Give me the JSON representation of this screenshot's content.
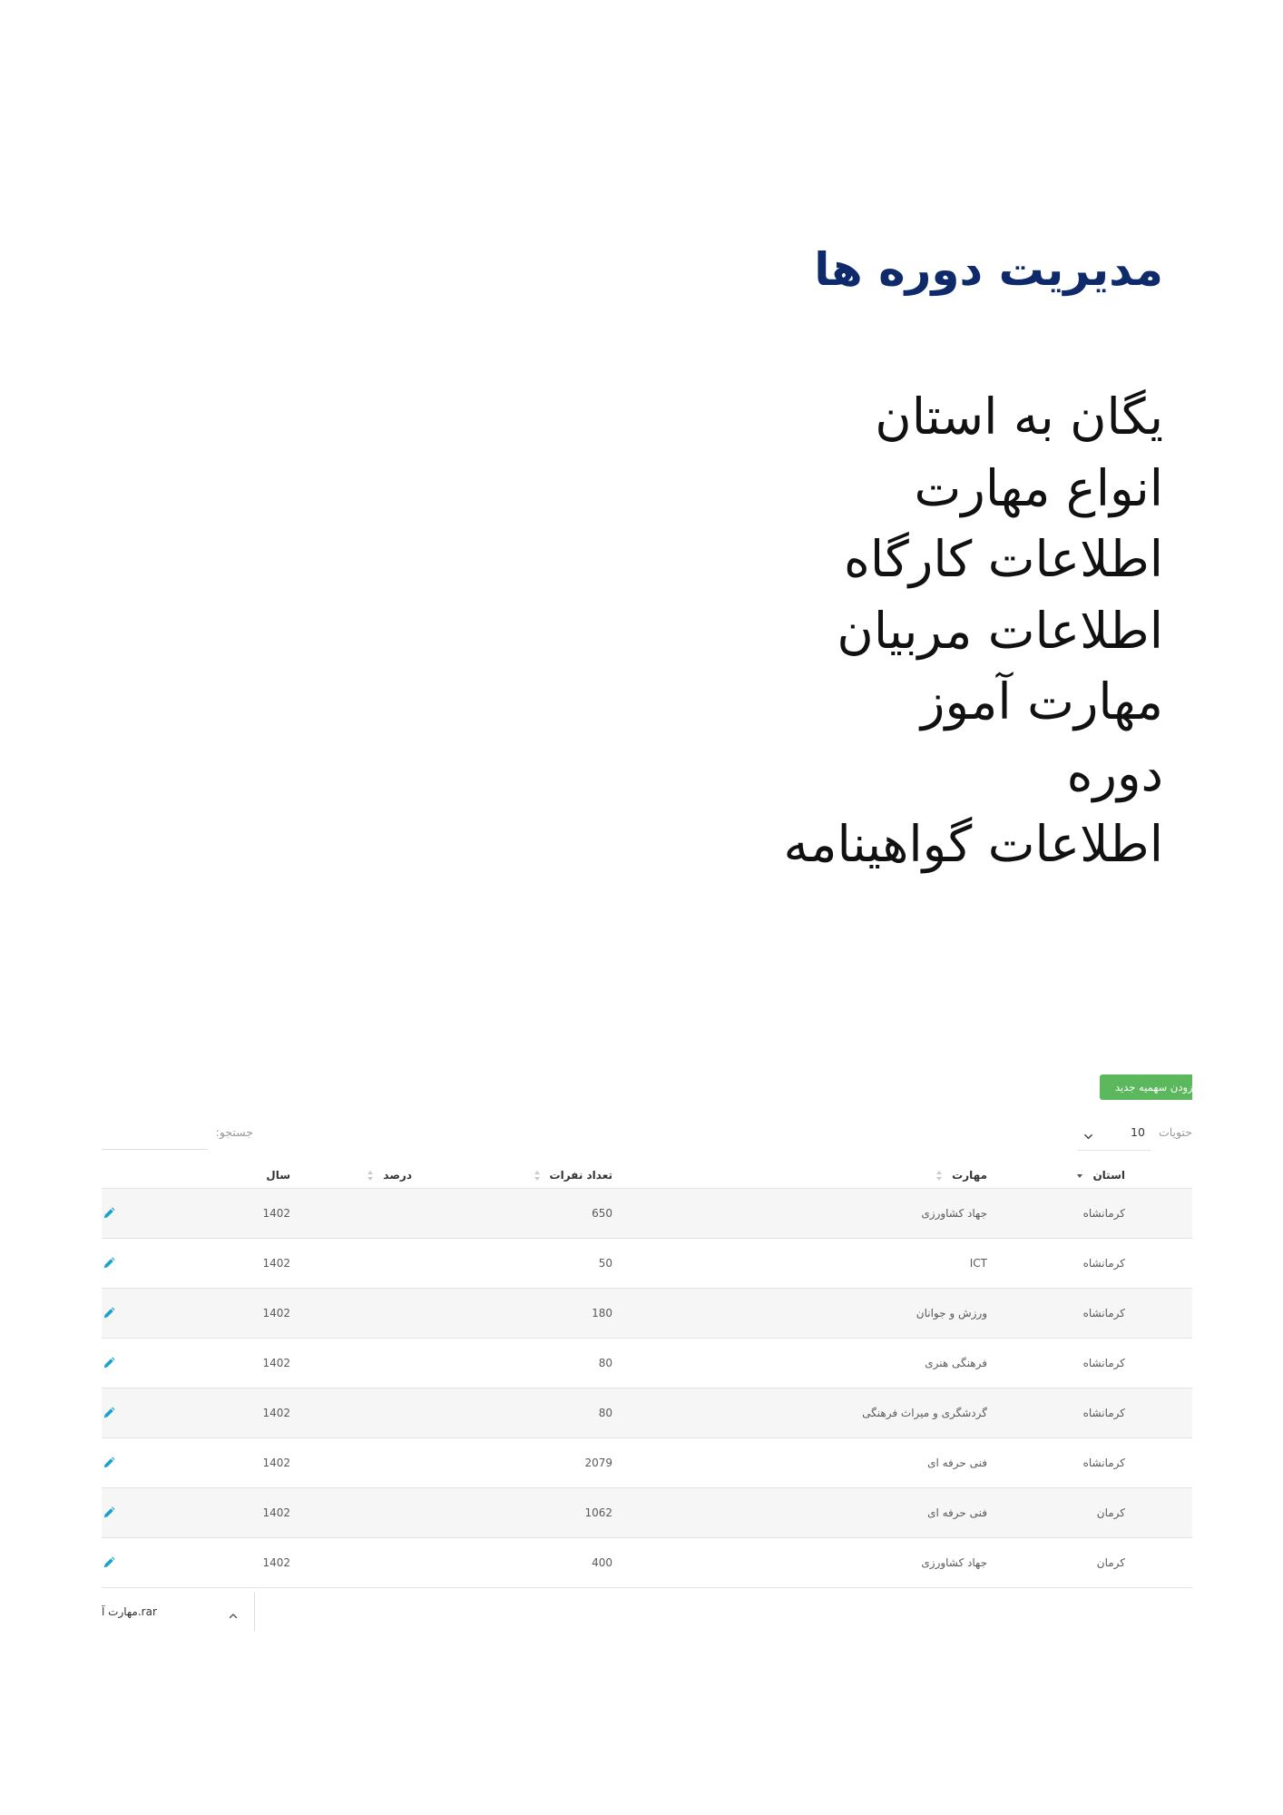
{
  "document": {
    "title": "مدیریت دوره ها",
    "items": [
      "یگان به استان",
      "انواع مهارت",
      "اطلاعات کارگاه",
      "اطلاعات مربیان",
      "مهارت آموز",
      "دوره",
      "اطلاعات گواهینامه"
    ]
  },
  "screenshot": {
    "add_button": {
      "label": "زودن سهمیه جدید"
    },
    "page_length": {
      "label": "حتویات",
      "value": "10",
      "icon": "chevron-down-icon"
    },
    "search": {
      "label": "جستجو:",
      "value": ""
    },
    "table": {
      "columns": [
        {
          "label": "استان",
          "sort_icon": "sort-desc-icon"
        },
        {
          "label": "مهارت",
          "sort_icon": "sort-icon"
        },
        {
          "label": "تعداد نفرات",
          "sort_icon": "sort-icon"
        },
        {
          "label": "درصد",
          "sort_icon": "sort-icon"
        },
        {
          "label": "سال"
        }
      ],
      "row_action_icon": "edit-icon",
      "rows": [
        {
          "province": "کرمانشاه",
          "skill": "جهاد کشاورزی",
          "count": 650,
          "percent": "",
          "year": 1402
        },
        {
          "province": "کرمانشاه",
          "skill": "ICT",
          "count": 50,
          "percent": "",
          "year": 1402
        },
        {
          "province": "کرمانشاه",
          "skill": "ورزش و جوانان",
          "count": 180,
          "percent": "",
          "year": 1402
        },
        {
          "province": "کرمانشاه",
          "skill": "فرهنگی هنری",
          "count": 80,
          "percent": "",
          "year": 1402
        },
        {
          "province": "کرمانشاه",
          "skill": "گردشگری و میراث فرهنگی",
          "count": 80,
          "percent": "",
          "year": 1402
        },
        {
          "province": "کرمانشاه",
          "skill": "فنی حرفه ای",
          "count": 2079,
          "percent": "",
          "year": 1402
        },
        {
          "province": "کرمان",
          "skill": "فنی حرفه ای",
          "count": 1062,
          "percent": "",
          "year": 1402
        },
        {
          "province": "کرمان",
          "skill": "جهاد کشاورزی",
          "count": 400,
          "percent": "",
          "year": 1402
        }
      ]
    },
    "download_bar": {
      "file_name": "مهارت آ.rar",
      "icon": "chevron-up-icon"
    }
  },
  "colors": {
    "title": "#0e2a6b",
    "add_button": "#5cb85c",
    "edit_icon": "#1aa3c9",
    "table_stripe": "#f6f6f6"
  }
}
